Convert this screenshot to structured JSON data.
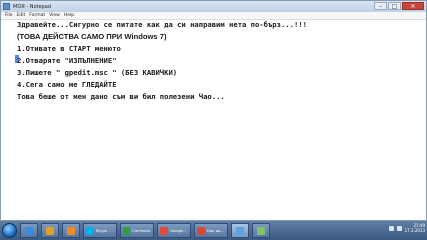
{
  "window": {
    "title": "МОЯ - Notepad",
    "controls": {
      "minimize": "–",
      "maximize": "□",
      "close": "✕"
    }
  },
  "menu": [
    "File",
    "Edit",
    "Format",
    "View",
    "Help"
  ],
  "document": {
    "lines": [
      "Здравейте...Сигурно се питате как да си направим нета по-бърз...!!!",
      "(ТОВА ДЕЙСТВА САМО ПРИ Windows 7)",
      "1.Отивате в СТАРТ менюто",
      "2.Отваряте \"ИЗПЪЛНЕНИЕ\"",
      "3.Пишете \" gpedit.msc \" (БЕЗ КАВИЧКИ)",
      "4.Сега само ме ГЛЕДАЙТЕ",
      "Това беше от мен дано съм ви бил полезени Чао..."
    ]
  },
  "taskbar": {
    "items": [
      {
        "label": "",
        "color": "#3a8fd8"
      },
      {
        "label": "",
        "color": "#e0a020"
      },
      {
        "label": "",
        "color": "#f08a24"
      },
      {
        "label": "Skype - ...",
        "color": "#00aff0"
      },
      {
        "label": "Camtasia...",
        "color": "#2e9e3e"
      },
      {
        "label": "Google...",
        "color": "#e04b3b"
      },
      {
        "label": "Как да...",
        "color": "#d24b3a"
      },
      {
        "label": "",
        "color": "#5aa2e0"
      },
      {
        "label": "",
        "color": "#7cc36a"
      }
    ],
    "clock": {
      "time": "21:09",
      "date": "17.3.2013"
    }
  }
}
